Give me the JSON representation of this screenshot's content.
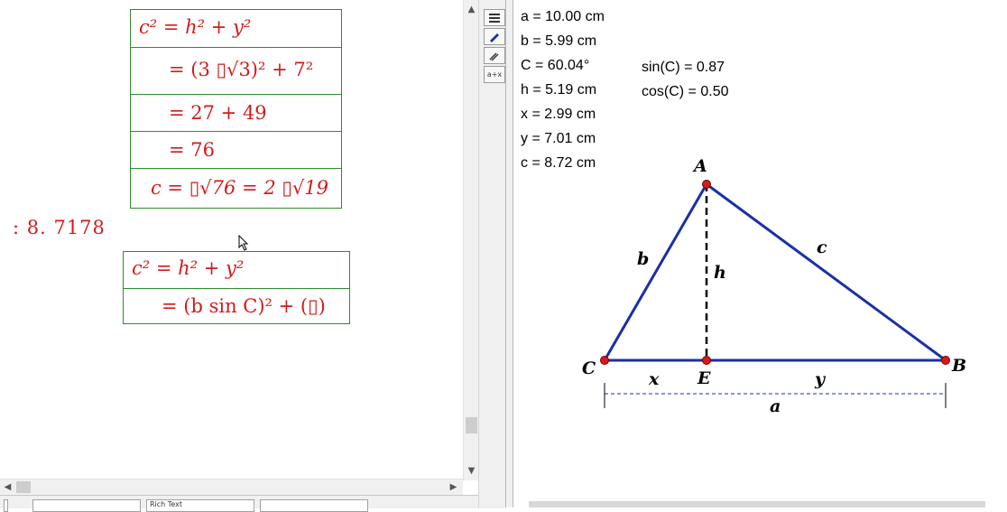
{
  "left_pane": {
    "box1": {
      "row1": "c² = h² + y²",
      "row2": "= (3 ▯√3)² + 7²",
      "row3": "= 27 + 49",
      "row4": "= 76",
      "row5": "c = ▯√76 = 2 ▯√19"
    },
    "result": ": 8. 7178",
    "box2": {
      "row1": "c² = h² + y²",
      "row2": "= (b sin C)² + (▯)"
    }
  },
  "statusbar": {
    "field1": "",
    "field2": "Rich Text",
    "field3": ""
  },
  "toolbar": {
    "btn4_label": "a+x"
  },
  "measurements": {
    "a": "a = 10.00 cm",
    "b": "b = 5.99 cm",
    "C": "C = 60.04°",
    "h": "h = 5.19 cm",
    "x": "x = 2.99 cm",
    "y": "y = 7.01 cm",
    "c": "c = 8.72 cm",
    "sinC": "sin(C) = 0.87",
    "cosC": "cos(C) = 0.50"
  },
  "diagram": {
    "labels": {
      "A": "A",
      "B": "B",
      "C": "C",
      "E": "E",
      "b": "b",
      "c": "c",
      "h": "h",
      "x": "x",
      "y": "y",
      "a": "a"
    },
    "colors": {
      "triangle": "#1a2fa8",
      "points": "#d41a1a",
      "math": "#d41a1a"
    }
  }
}
